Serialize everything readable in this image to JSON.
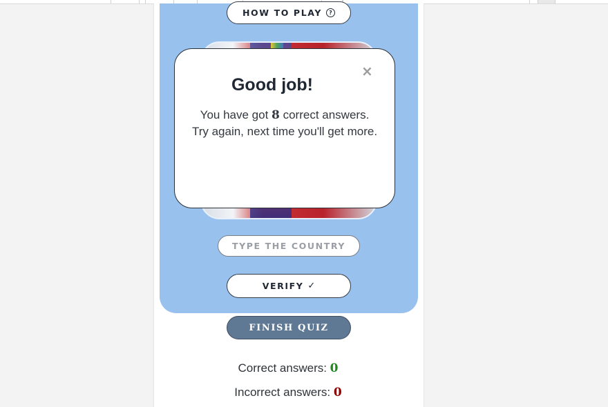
{
  "buttons": {
    "how_to_play": "HOW TO PLAY",
    "help_icon_glyph": "?",
    "verify": "VERIFY",
    "verify_icon_glyph": "✓",
    "finish_quiz": "FINISH QUIZ"
  },
  "modal": {
    "title": "Good job!",
    "close_glyph": "×",
    "line1_prefix": "You have got ",
    "correct_count": "8",
    "line1_suffix": " correct answers.",
    "line2": "Try again, next time you'll get more."
  },
  "input": {
    "placeholder": "TYPE THE COUNTRY",
    "value": ""
  },
  "stats": {
    "correct_label": "Correct answers: ",
    "correct_value": "0",
    "incorrect_label": "Incorrect answers: ",
    "incorrect_value": "0"
  },
  "colors": {
    "panel": "#98c1ee",
    "finish_button": "#5f7893",
    "correct": "#1c8a1c",
    "incorrect": "#8b0000"
  },
  "icons": [
    "help-circle-icon",
    "close-icon",
    "check-icon"
  ]
}
